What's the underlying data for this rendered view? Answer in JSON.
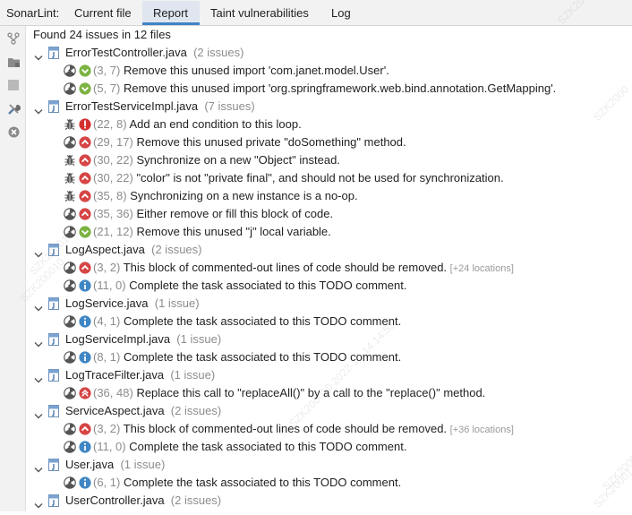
{
  "header": {
    "title": "SonarLint:",
    "tabs": [
      {
        "label": "Current file"
      },
      {
        "label": "Report"
      },
      {
        "label": "Taint vulnerabilities"
      },
      {
        "label": "Log"
      }
    ],
    "selected_tab": "Report"
  },
  "toolbar": {
    "icons": [
      "branch-icon",
      "folder-icon",
      "stop-icon",
      "tools-icon",
      "clear-icon"
    ]
  },
  "summary": "Found 24 issues in 12 files",
  "files": [
    {
      "name": "ErrorTestController.java",
      "count": "(2 issues)",
      "issues": [
        {
          "type": "code-smell",
          "severity": "minor",
          "pos": "(3, 7)",
          "msg": "Remove this unused import 'com.janet.model.User'.",
          "extra": ""
        },
        {
          "type": "code-smell",
          "severity": "minor",
          "pos": "(5, 7)",
          "msg": "Remove this unused import 'org.springframework.web.bind.annotation.GetMapping'.",
          "extra": ""
        }
      ]
    },
    {
      "name": "ErrorTestServiceImpl.java",
      "count": "(7 issues)",
      "issues": [
        {
          "type": "bug",
          "severity": "blocker",
          "pos": "(22, 8)",
          "msg": "Add an end condition to this loop.",
          "extra": ""
        },
        {
          "type": "code-smell",
          "severity": "major",
          "pos": "(29, 17)",
          "msg": "Remove this unused private \"doSomething\" method.",
          "extra": ""
        },
        {
          "type": "bug",
          "severity": "major",
          "pos": "(30, 22)",
          "msg": "Synchronize on a new \"Object\" instead.",
          "extra": ""
        },
        {
          "type": "bug",
          "severity": "major",
          "pos": "(30, 22)",
          "msg": "\"color\" is not \"private final\", and should not be used for synchronization.",
          "extra": ""
        },
        {
          "type": "bug",
          "severity": "major",
          "pos": "(35, 8)",
          "msg": "Synchronizing on a new instance is a no-op.",
          "extra": ""
        },
        {
          "type": "code-smell",
          "severity": "major",
          "pos": "(35, 36)",
          "msg": "Either remove or fill this block of code.",
          "extra": ""
        },
        {
          "type": "code-smell",
          "severity": "minor",
          "pos": "(21, 12)",
          "msg": "Remove this unused \"j\" local variable.",
          "extra": ""
        }
      ]
    },
    {
      "name": "LogAspect.java",
      "count": "(2 issues)",
      "issues": [
        {
          "type": "code-smell",
          "severity": "major",
          "pos": "(3, 2)",
          "msg": "This block of commented-out lines of code should be removed.",
          "extra": "[+24 locations]"
        },
        {
          "type": "code-smell",
          "severity": "info",
          "pos": "(11, 0)",
          "msg": "Complete the task associated to this TODO comment.",
          "extra": ""
        }
      ]
    },
    {
      "name": "LogService.java",
      "count": "(1 issue)",
      "issues": [
        {
          "type": "code-smell",
          "severity": "info",
          "pos": "(4, 1)",
          "msg": "Complete the task associated to this TODO comment.",
          "extra": ""
        }
      ]
    },
    {
      "name": "LogServiceImpl.java",
      "count": "(1 issue)",
      "issues": [
        {
          "type": "code-smell",
          "severity": "info",
          "pos": "(8, 1)",
          "msg": "Complete the task associated to this TODO comment.",
          "extra": ""
        }
      ]
    },
    {
      "name": "LogTraceFilter.java",
      "count": "(1 issue)",
      "issues": [
        {
          "type": "code-smell",
          "severity": "critical",
          "pos": "(36, 48)",
          "msg": "Replace this call to \"replaceAll()\" by a call to the \"replace()\" method.",
          "extra": ""
        }
      ]
    },
    {
      "name": "ServiceAspect.java",
      "count": "(2 issues)",
      "issues": [
        {
          "type": "code-smell",
          "severity": "major",
          "pos": "(3, 2)",
          "msg": "This block of commented-out lines of code should be removed.",
          "extra": "[+36 locations]"
        },
        {
          "type": "code-smell",
          "severity": "info",
          "pos": "(11, 0)",
          "msg": "Complete the task associated to this TODO comment.",
          "extra": ""
        }
      ]
    },
    {
      "name": "User.java",
      "count": "(1 issue)",
      "issues": [
        {
          "type": "code-smell",
          "severity": "info",
          "pos": "(6, 1)",
          "msg": "Complete the task associated to this TODO comment.",
          "extra": ""
        }
      ]
    },
    {
      "name": "UserController.java",
      "count": "(2 issues)",
      "issues": []
    }
  ],
  "watermarks": [
    "SZK2000",
    "SZK20001",
    "SZK200010",
    "SZK20001",
    "SZK20001",
    "SZK200010 2022-10-14 14:53",
    "SZK20001"
  ],
  "colors": {
    "accent": "#4083c9",
    "blocker": "#d32f2f",
    "major": "#d64545",
    "minor": "#7cb342",
    "info": "#3f86c5",
    "critical": "#d64545"
  }
}
